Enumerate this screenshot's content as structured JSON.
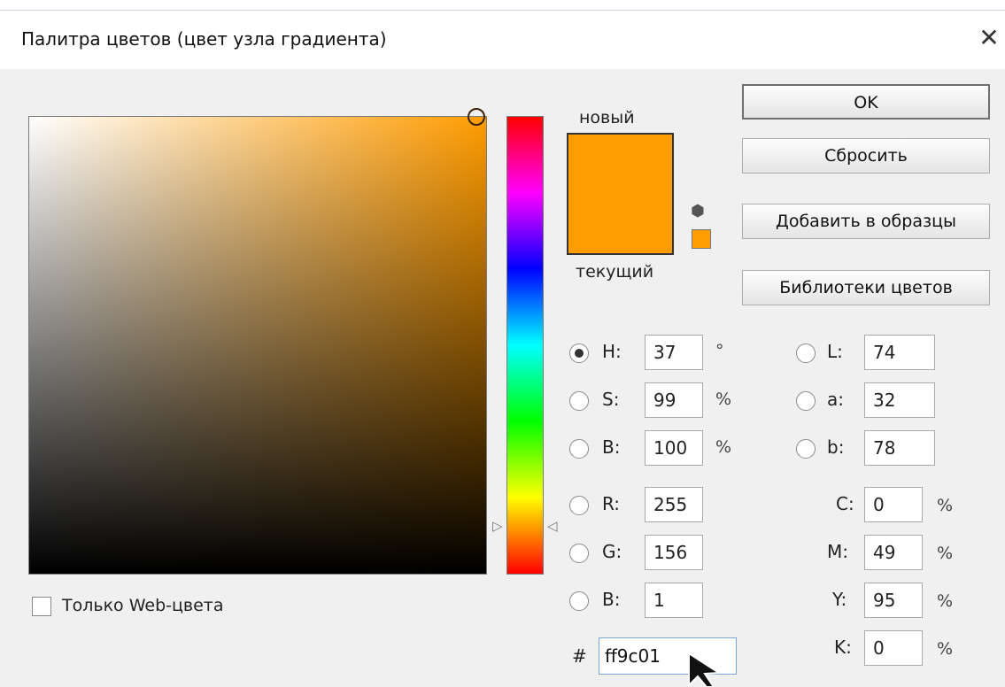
{
  "window": {
    "title": "Палитра цветов (цвет узла градиента)",
    "close_symbol": "✕"
  },
  "preview": {
    "new_label": "новый",
    "current_label": "текущий",
    "new_color": "#ff9c01",
    "current_color": "#ff9c01"
  },
  "buttons": {
    "ok": "OK",
    "reset": "Сбросить",
    "add_to_swatches": "Добавить в образцы",
    "color_libraries": "Библиотеки цветов"
  },
  "hsb": {
    "h_label": "H:",
    "h_value": "37",
    "h_unit": "°",
    "s_label": "S:",
    "s_value": "99",
    "s_unit": "%",
    "b_label": "B:",
    "b_value": "100",
    "b_unit": "%"
  },
  "rgb": {
    "r_label": "R:",
    "r_value": "255",
    "g_label": "G:",
    "g_value": "156",
    "b_label": "B:",
    "b_value": "1"
  },
  "lab": {
    "l_label": "L:",
    "l_value": "74",
    "a_label": "a:",
    "a_value": "32",
    "b_label": "b:",
    "b_value": "78"
  },
  "cmyk": {
    "c_label": "C:",
    "c_value": "0",
    "c_unit": "%",
    "m_label": "M:",
    "m_value": "49",
    "m_unit": "%",
    "y_label": "Y:",
    "y_value": "95",
    "y_unit": "%",
    "k_label": "K:",
    "k_value": "0",
    "k_unit": "%"
  },
  "hex": {
    "hash": "#",
    "value": "ff9c01"
  },
  "web_only": {
    "label": "Только Web-цвета",
    "checked": false
  },
  "selected_mode": "H",
  "icons": {
    "cube": "cube-icon",
    "close": "close-icon"
  }
}
